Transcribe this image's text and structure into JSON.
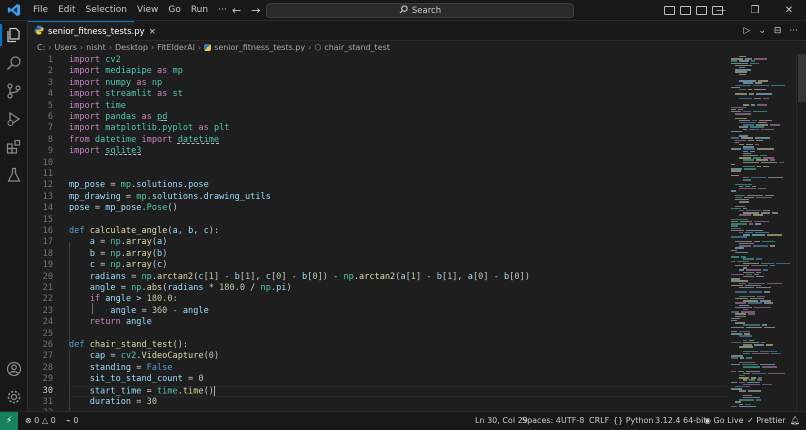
{
  "titlebar": {
    "menu": [
      "File",
      "Edit",
      "Selection",
      "View",
      "Go",
      "Run",
      "···"
    ],
    "back_arrow": "←",
    "forward_arrow": "→",
    "search_placeholder": "Search",
    "window_controls": [
      "—",
      "❐",
      "✕"
    ]
  },
  "tab": {
    "name": "senior_fitness_tests.py",
    "close": "×"
  },
  "editor_actions": [
    "▷",
    "⌄",
    "⊟",
    "···"
  ],
  "breadcrumb": [
    "C:",
    "Users",
    "nisht",
    "Desktop",
    "FitElderAI",
    "senior_fitness_tests.py",
    "chair_stand_test"
  ],
  "code_lines": [
    {
      "n": "1",
      "segs": [
        [
          "k",
          "import"
        ],
        [
          "t",
          " "
        ],
        [
          "m",
          "cv2"
        ]
      ]
    },
    {
      "n": "2",
      "segs": [
        [
          "k",
          "import"
        ],
        [
          "t",
          " "
        ],
        [
          "m",
          "mediapipe"
        ],
        [
          "t",
          " "
        ],
        [
          "k",
          "as"
        ],
        [
          "t",
          " "
        ],
        [
          "m",
          "mp"
        ]
      ]
    },
    {
      "n": "3",
      "segs": [
        [
          "k",
          "import"
        ],
        [
          "t",
          " "
        ],
        [
          "m",
          "numpy"
        ],
        [
          "t",
          " "
        ],
        [
          "k",
          "as"
        ],
        [
          "t",
          " "
        ],
        [
          "m",
          "np"
        ]
      ]
    },
    {
      "n": "4",
      "segs": [
        [
          "k",
          "import"
        ],
        [
          "t",
          " "
        ],
        [
          "m",
          "streamlit"
        ],
        [
          "t",
          " "
        ],
        [
          "k",
          "as"
        ],
        [
          "t",
          " "
        ],
        [
          "m",
          "st"
        ]
      ]
    },
    {
      "n": "5",
      "segs": [
        [
          "k",
          "import"
        ],
        [
          "t",
          " "
        ],
        [
          "m",
          "time"
        ]
      ]
    },
    {
      "n": "6",
      "segs": [
        [
          "k",
          "import"
        ],
        [
          "t",
          " "
        ],
        [
          "m",
          "pandas"
        ],
        [
          "t",
          " "
        ],
        [
          "k",
          "as"
        ],
        [
          "t",
          " "
        ],
        [
          "mw",
          "pd"
        ]
      ]
    },
    {
      "n": "7",
      "segs": [
        [
          "k",
          "import"
        ],
        [
          "t",
          " "
        ],
        [
          "m",
          "matplotlib.pyplot"
        ],
        [
          "t",
          " "
        ],
        [
          "k",
          "as"
        ],
        [
          "t",
          " "
        ],
        [
          "m",
          "plt"
        ]
      ]
    },
    {
      "n": "8",
      "segs": [
        [
          "k",
          "from"
        ],
        [
          "t",
          " "
        ],
        [
          "m",
          "datetime"
        ],
        [
          "t",
          " "
        ],
        [
          "k",
          "import"
        ],
        [
          "t",
          " "
        ],
        [
          "mw",
          "datetime"
        ]
      ]
    },
    {
      "n": "9",
      "segs": [
        [
          "k",
          "import"
        ],
        [
          "t",
          " "
        ],
        [
          "mw",
          "sqlite3"
        ]
      ]
    },
    {
      "n": "10",
      "segs": []
    },
    {
      "n": "11",
      "segs": []
    },
    {
      "n": "12",
      "segs": [
        [
          "v",
          "mp_pose"
        ],
        [
          "t",
          " = "
        ],
        [
          "m",
          "mp"
        ],
        [
          "t",
          "."
        ],
        [
          "v",
          "solutions"
        ],
        [
          "t",
          "."
        ],
        [
          "v",
          "pose"
        ]
      ]
    },
    {
      "n": "13",
      "segs": [
        [
          "v",
          "mp_drawing"
        ],
        [
          "t",
          " = "
        ],
        [
          "m",
          "mp"
        ],
        [
          "t",
          "."
        ],
        [
          "v",
          "solutions"
        ],
        [
          "t",
          "."
        ],
        [
          "v",
          "drawing_utils"
        ]
      ]
    },
    {
      "n": "14",
      "segs": [
        [
          "v",
          "pose"
        ],
        [
          "t",
          " = "
        ],
        [
          "v",
          "mp_pose"
        ],
        [
          "t",
          "."
        ],
        [
          "m",
          "Pose"
        ],
        [
          "t",
          "()"
        ]
      ]
    },
    {
      "n": "15",
      "segs": []
    },
    {
      "n": "16",
      "segs": [
        [
          "d",
          "def"
        ],
        [
          "t",
          " "
        ],
        [
          "f",
          "calculate_angle"
        ],
        [
          "t",
          "("
        ],
        [
          "v",
          "a"
        ],
        [
          "t",
          ", "
        ],
        [
          "v",
          "b"
        ],
        [
          "t",
          ", "
        ],
        [
          "v",
          "c"
        ],
        [
          "t",
          "):"
        ]
      ]
    },
    {
      "n": "17",
      "segs": [
        [
          "t",
          "    "
        ],
        [
          "v",
          "a"
        ],
        [
          "t",
          " = "
        ],
        [
          "m",
          "np"
        ],
        [
          "t",
          "."
        ],
        [
          "f",
          "array"
        ],
        [
          "t",
          "("
        ],
        [
          "v",
          "a"
        ],
        [
          "t",
          ")"
        ]
      ]
    },
    {
      "n": "18",
      "segs": [
        [
          "t",
          "    "
        ],
        [
          "v",
          "b"
        ],
        [
          "t",
          " = "
        ],
        [
          "m",
          "np"
        ],
        [
          "t",
          "."
        ],
        [
          "f",
          "array"
        ],
        [
          "t",
          "("
        ],
        [
          "v",
          "b"
        ],
        [
          "t",
          ")"
        ]
      ]
    },
    {
      "n": "19",
      "segs": [
        [
          "t",
          "    "
        ],
        [
          "v",
          "c"
        ],
        [
          "t",
          " = "
        ],
        [
          "m",
          "np"
        ],
        [
          "t",
          "."
        ],
        [
          "f",
          "array"
        ],
        [
          "t",
          "("
        ],
        [
          "v",
          "c"
        ],
        [
          "t",
          ")"
        ]
      ]
    },
    {
      "n": "20",
      "segs": [
        [
          "t",
          "    "
        ],
        [
          "v",
          "radians"
        ],
        [
          "t",
          " = "
        ],
        [
          "m",
          "np"
        ],
        [
          "t",
          "."
        ],
        [
          "f",
          "arctan2"
        ],
        [
          "t",
          "("
        ],
        [
          "v",
          "c"
        ],
        [
          "t",
          "["
        ],
        [
          "n",
          "1"
        ],
        [
          "t",
          "] - "
        ],
        [
          "v",
          "b"
        ],
        [
          "t",
          "["
        ],
        [
          "n",
          "1"
        ],
        [
          "t",
          "], "
        ],
        [
          "v",
          "c"
        ],
        [
          "t",
          "["
        ],
        [
          "n",
          "0"
        ],
        [
          "t",
          "] - "
        ],
        [
          "v",
          "b"
        ],
        [
          "t",
          "["
        ],
        [
          "n",
          "0"
        ],
        [
          "t",
          "]) - "
        ],
        [
          "m",
          "np"
        ],
        [
          "t",
          "."
        ],
        [
          "f",
          "arctan2"
        ],
        [
          "t",
          "("
        ],
        [
          "v",
          "a"
        ],
        [
          "t",
          "["
        ],
        [
          "n",
          "1"
        ],
        [
          "t",
          "] - "
        ],
        [
          "v",
          "b"
        ],
        [
          "t",
          "["
        ],
        [
          "n",
          "1"
        ],
        [
          "t",
          "], "
        ],
        [
          "v",
          "a"
        ],
        [
          "t",
          "["
        ],
        [
          "n",
          "0"
        ],
        [
          "t",
          "] - "
        ],
        [
          "v",
          "b"
        ],
        [
          "t",
          "["
        ],
        [
          "n",
          "0"
        ],
        [
          "t",
          "])"
        ]
      ]
    },
    {
      "n": "21",
      "segs": [
        [
          "t",
          "    "
        ],
        [
          "v",
          "angle"
        ],
        [
          "t",
          " = "
        ],
        [
          "m",
          "np"
        ],
        [
          "t",
          "."
        ],
        [
          "f",
          "abs"
        ],
        [
          "t",
          "("
        ],
        [
          "v",
          "radians"
        ],
        [
          "t",
          " * "
        ],
        [
          "n",
          "180.0"
        ],
        [
          "t",
          " / "
        ],
        [
          "m",
          "np"
        ],
        [
          "t",
          "."
        ],
        [
          "v",
          "pi"
        ],
        [
          "t",
          ")"
        ]
      ]
    },
    {
      "n": "22",
      "segs": [
        [
          "t",
          "    "
        ],
        [
          "k",
          "if"
        ],
        [
          "t",
          " "
        ],
        [
          "v",
          "angle"
        ],
        [
          "t",
          " > "
        ],
        [
          "n",
          "180.0"
        ],
        [
          "t",
          ":"
        ]
      ]
    },
    {
      "n": "23",
      "segs": [
        [
          "t",
          "        "
        ],
        [
          "v",
          "angle"
        ],
        [
          "t",
          " = "
        ],
        [
          "n",
          "360"
        ],
        [
          "t",
          " - "
        ],
        [
          "v",
          "angle"
        ]
      ]
    },
    {
      "n": "24",
      "segs": [
        [
          "t",
          "    "
        ],
        [
          "k",
          "return"
        ],
        [
          "t",
          " "
        ],
        [
          "v",
          "angle"
        ]
      ]
    },
    {
      "n": "25",
      "segs": []
    },
    {
      "n": "26",
      "segs": [
        [
          "d",
          "def"
        ],
        [
          "t",
          " "
        ],
        [
          "f",
          "chair_stand_test"
        ],
        [
          "t",
          "():"
        ]
      ]
    },
    {
      "n": "27",
      "segs": [
        [
          "t",
          "    "
        ],
        [
          "v",
          "cap"
        ],
        [
          "t",
          " = "
        ],
        [
          "m",
          "cv2"
        ],
        [
          "t",
          "."
        ],
        [
          "f",
          "VideoCapture"
        ],
        [
          "t",
          "("
        ],
        [
          "n",
          "0"
        ],
        [
          "t",
          ")"
        ]
      ]
    },
    {
      "n": "28",
      "segs": [
        [
          "t",
          "    "
        ],
        [
          "v",
          "standing"
        ],
        [
          "t",
          " = "
        ],
        [
          "d",
          "False"
        ]
      ]
    },
    {
      "n": "29",
      "segs": [
        [
          "t",
          "    "
        ],
        [
          "v",
          "sit_to_stand_count"
        ],
        [
          "t",
          " = "
        ],
        [
          "n",
          "0"
        ]
      ]
    },
    {
      "n": "30",
      "segs": [
        [
          "t",
          "    "
        ],
        [
          "v",
          "start_time"
        ],
        [
          "t",
          " = "
        ],
        [
          "m",
          "time"
        ],
        [
          "t",
          "."
        ],
        [
          "f",
          "time"
        ],
        [
          "t",
          "()"
        ]
      ]
    },
    {
      "n": "31",
      "segs": [
        [
          "t",
          "    "
        ],
        [
          "v",
          "duration"
        ],
        [
          "t",
          " = "
        ],
        [
          "n",
          "30"
        ]
      ]
    },
    {
      "n": "32",
      "segs": []
    }
  ],
  "status": {
    "errors": "0",
    "warnings": "0",
    "ports": "0",
    "position": "Ln 30, Col 29",
    "spaces": "Spaces: 4",
    "encoding": "UTF-8",
    "eol": "CRLF",
    "language": "Python",
    "interpreter": "3.12.4 64-bit",
    "golive": "Go Live",
    "prettier": "Prettier"
  },
  "colors": {
    "keyword": "#c586c0",
    "def": "#569cd6",
    "function": "#dcdcaa",
    "number": "#b5cea8",
    "variable": "#9cdcfe",
    "module": "#4ec9b0",
    "accent": "#0078d4"
  }
}
